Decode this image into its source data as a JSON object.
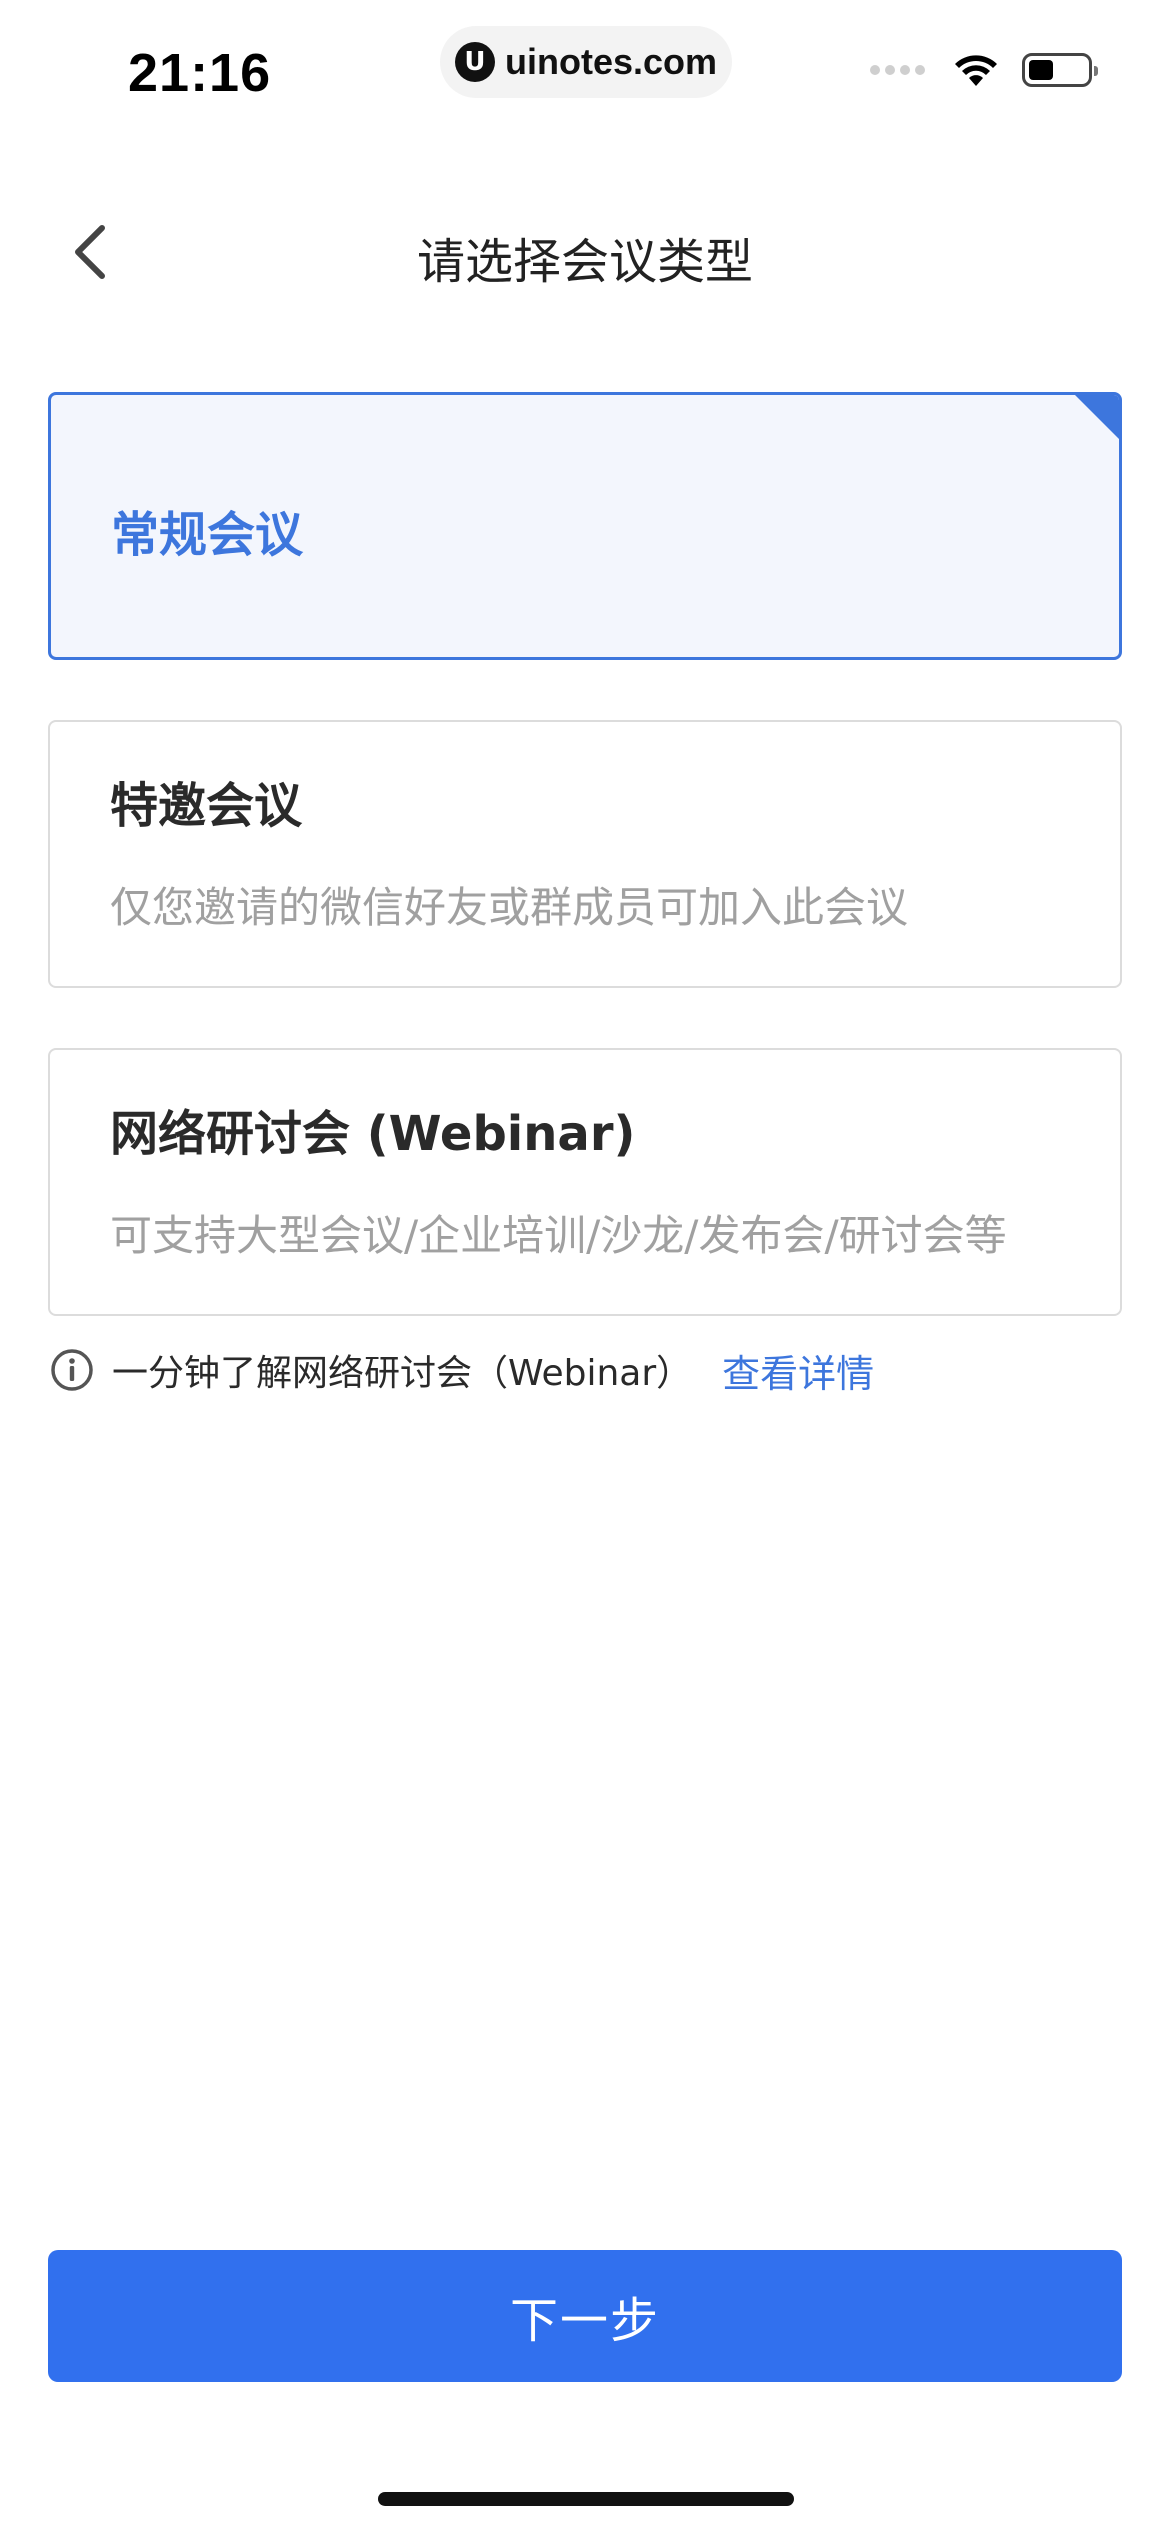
{
  "status_bar": {
    "time": "21:16",
    "url": "uinotes.com",
    "logo_letter": "U"
  },
  "nav": {
    "title": "请选择会议类型",
    "back_icon": "chevron-left-icon"
  },
  "options": [
    {
      "title": "常规会议",
      "description": "",
      "selected": true
    },
    {
      "title": "特邀会议",
      "description": "仅您邀请的微信好友或群成员可加入此会议",
      "selected": false
    },
    {
      "title": "网络研讨会 (Webinar)",
      "description": "可支持大型会议/企业培训/沙龙/发布会/研讨会等",
      "selected": false
    }
  ],
  "info": {
    "text": "一分钟了解网络研讨会（Webinar）",
    "link": "查看详情",
    "icon": "info-icon"
  },
  "footer": {
    "next_label": "下一步"
  },
  "colors": {
    "accent": "#3d76dd",
    "primary_button": "#3170ee",
    "selected_bg": "#f3f6fd",
    "muted_text": "#a0a0a0"
  }
}
